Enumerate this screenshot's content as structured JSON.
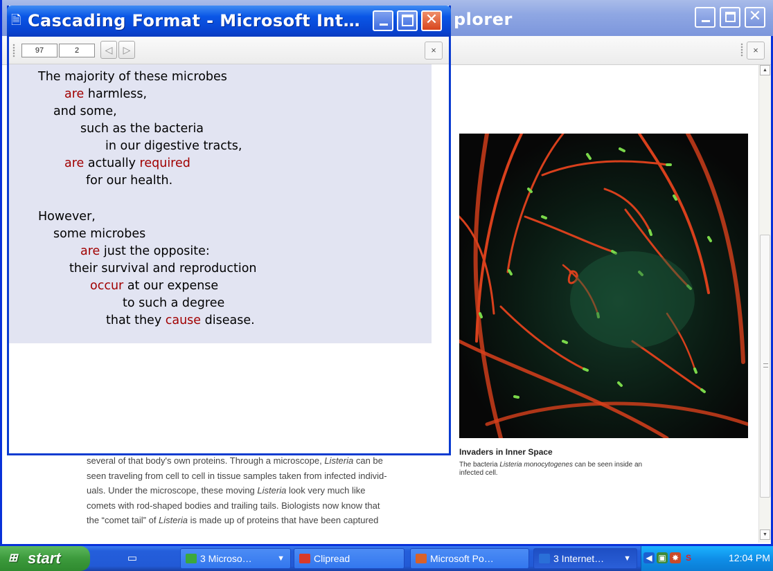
{
  "background_window": {
    "title_partial": "plorer",
    "close_label": "×",
    "scroll_up": "▲",
    "scroll_down": "▼",
    "image_caption_title": "Invaders in Inner Space",
    "image_caption_text_1": "The bacteria ",
    "image_caption_species": "Listeria monocytogenes",
    "image_caption_text_2": " can be seen inside an infected cell.",
    "body_text": [
      [
        "several of that body's own proteins. Through a microscope, ",
        "Listeria",
        " can be"
      ],
      [
        "seen traveling from cell to cell in tissue samples taken from infected individ-",
        "",
        ""
      ],
      [
        "uals. Under the microscope, these moving ",
        "Listeria",
        " look very much like"
      ],
      [
        "comets with rod-shaped bodies and trailing tails. Biologists now know that",
        "",
        ""
      ],
      [
        "the “comet tail” of ",
        "Listeria",
        " is made up of proteins that have been captured"
      ]
    ]
  },
  "foreground_window": {
    "title": "Cascading Format - Microsoft Int…",
    "title_icon": "ie-page-icon",
    "toolbar": {
      "page_number": "97",
      "page_sub": "2",
      "prev_label": "◁",
      "next_label": "▷",
      "close_label": "×"
    },
    "cascade_lines": [
      [
        {
          "t": "The majority of these microbes",
          "v": false
        }
      ],
      [
        {
          "t": "are",
          "v": true
        },
        {
          "t": " harmless,",
          "v": false
        }
      ],
      [
        {
          "t": "and some,",
          "v": false
        }
      ],
      [
        {
          "t": "such as the bacteria",
          "v": false
        }
      ],
      [
        {
          "t": "in our digestive tracts,",
          "v": false
        }
      ],
      [
        {
          "t": "are",
          "v": true
        },
        {
          "t": " actually ",
          "v": false
        },
        {
          "t": "required",
          "v": true
        }
      ],
      [
        {
          "t": "for our health.",
          "v": false
        }
      ],
      [
        {
          "t": "However,",
          "v": false
        }
      ],
      [
        {
          "t": "some microbes",
          "v": false
        }
      ],
      [
        {
          "t": "are",
          "v": true
        },
        {
          "t": " just the opposite:",
          "v": false
        }
      ],
      [
        {
          "t": "their survival and reproduction",
          "v": false
        }
      ],
      [
        {
          "t": "occur",
          "v": true
        },
        {
          "t": " at our expense",
          "v": false
        }
      ],
      [
        {
          "t": "to such a degree",
          "v": false
        }
      ],
      [
        {
          "t": "that they ",
          "v": false
        },
        {
          "t": "cause",
          "v": true
        },
        {
          "t": " disease.",
          "v": false
        }
      ]
    ]
  },
  "taskbar": {
    "start_label": "start",
    "tasks": [
      {
        "label": "3 Microso…",
        "icon_color": "#3ca83c",
        "has_arrow": true,
        "active": false
      },
      {
        "label": "Clipread",
        "icon_color": "#d83a2a",
        "has_arrow": false,
        "active": false
      },
      {
        "label": "Microsoft Po…",
        "icon_color": "#d8612a",
        "has_arrow": false,
        "active": false
      },
      {
        "label": "3 Internet…",
        "icon_color": "#2a6fd8",
        "has_arrow": true,
        "active": true
      }
    ],
    "clock": "12:04 PM"
  },
  "colors": {
    "verb_red": "#a10000",
    "content_bg": "#e2e4f2"
  }
}
